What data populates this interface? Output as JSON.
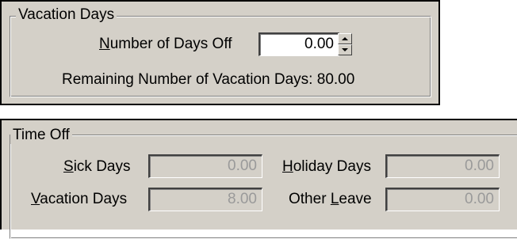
{
  "vacation_days_group": {
    "title": "Vacation Days",
    "days_off": {
      "label_mnemonic": "N",
      "label_rest": "umber of Days Off",
      "value": "0.00",
      "spin_up_icon": "arrow-up-icon",
      "spin_down_icon": "arrow-down-icon"
    },
    "remaining_label": "Remaining Number of Vacation Days:",
    "remaining_value": "80.00"
  },
  "time_off_group": {
    "title": "Time Off",
    "sick_days": {
      "label_mnemonic": "S",
      "label_rest": "ick Days",
      "value": "0.00"
    },
    "vacation_days": {
      "label_mnemonic": "V",
      "label_rest": "acation Days",
      "value": "8.00"
    },
    "holiday_days": {
      "label_mnemonic": "H",
      "label_rest": "oliday Days",
      "value": "0.00"
    },
    "other_leave": {
      "label_prefix": "Other ",
      "label_mnemonic": "L",
      "label_rest": "eave",
      "value": "0.00"
    }
  },
  "colors": {
    "dialog_face": "#d4d0c8",
    "disabled_text": "#9a9a9a"
  }
}
